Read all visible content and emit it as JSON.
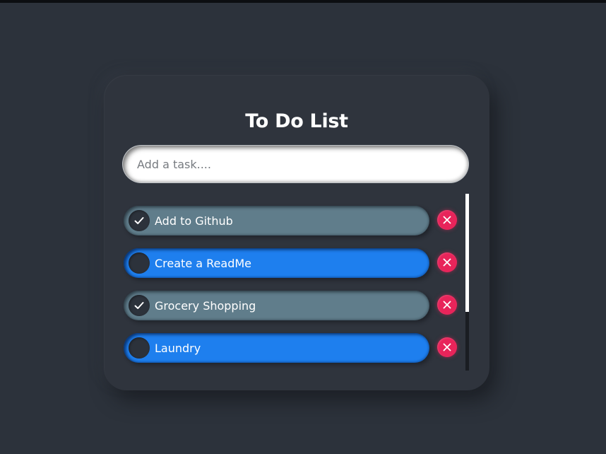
{
  "app": {
    "title": "To Do List"
  },
  "input": {
    "placeholder": "Add a task....",
    "value": ""
  },
  "tasks": [
    {
      "label": "Add to Github",
      "completed": true
    },
    {
      "label": "Create a ReadMe",
      "completed": false
    },
    {
      "label": "Grocery Shopping",
      "completed": true
    },
    {
      "label": "Laundry",
      "completed": false
    }
  ],
  "icons": {
    "check": "checkmark-icon",
    "delete": "close-icon"
  },
  "colors": {
    "background": "#2c323b",
    "card": "#2f343d",
    "completed_task": "#607d8b",
    "pending_task": "#1e7fee",
    "delete_button": "#e8245a",
    "text": "#ffffff"
  }
}
